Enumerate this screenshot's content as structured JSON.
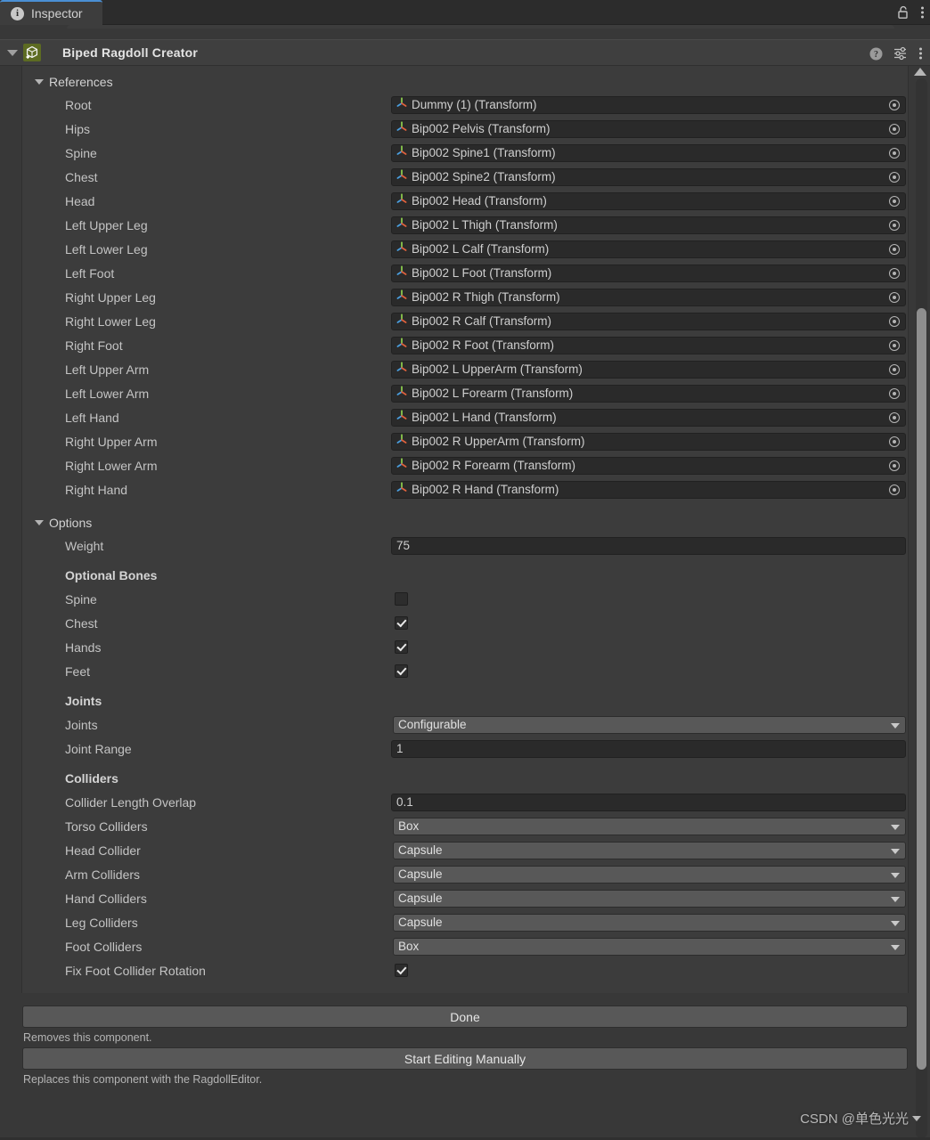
{
  "window": {
    "tab": {
      "label": "Inspector",
      "icon": "info-icon"
    },
    "tab_controls": [
      {
        "name": "lock-icon",
        "label": "Lock"
      },
      {
        "name": "more-menu-icon",
        "label": "More"
      }
    ]
  },
  "component": {
    "title": "Biped Ragdoll Creator",
    "icon": "script-cube-icon",
    "header_controls": [
      {
        "name": "help-icon",
        "label": "Help"
      },
      {
        "name": "preset-icon",
        "label": "Preset"
      },
      {
        "name": "component-menu-icon",
        "label": "Menu"
      }
    ]
  },
  "references": {
    "section_label": "References",
    "rows": [
      {
        "label": "Root",
        "value": "Dummy (1) (Transform)"
      },
      {
        "label": "Hips",
        "value": "Bip002 Pelvis (Transform)"
      },
      {
        "label": "Spine",
        "value": "Bip002 Spine1 (Transform)"
      },
      {
        "label": "Chest",
        "value": "Bip002 Spine2 (Transform)"
      },
      {
        "label": "Head",
        "value": "Bip002 Head (Transform)"
      },
      {
        "label": "Left Upper Leg",
        "value": "Bip002 L Thigh (Transform)"
      },
      {
        "label": "Left Lower Leg",
        "value": "Bip002 L Calf (Transform)"
      },
      {
        "label": "Left Foot",
        "value": "Bip002 L Foot (Transform)"
      },
      {
        "label": "Right Upper Leg",
        "value": "Bip002 R Thigh (Transform)"
      },
      {
        "label": "Right Lower Leg",
        "value": "Bip002 R Calf (Transform)"
      },
      {
        "label": "Right Foot",
        "value": "Bip002 R Foot (Transform)"
      },
      {
        "label": "Left Upper Arm",
        "value": "Bip002 L UpperArm (Transform)"
      },
      {
        "label": "Left Lower Arm",
        "value": "Bip002 L Forearm (Transform)"
      },
      {
        "label": "Left Hand",
        "value": "Bip002 L Hand (Transform)"
      },
      {
        "label": "Right Upper Arm",
        "value": "Bip002 R UpperArm (Transform)"
      },
      {
        "label": "Right Lower Arm",
        "value": "Bip002 R Forearm (Transform)"
      },
      {
        "label": "Right Hand",
        "value": "Bip002 R Hand (Transform)"
      }
    ]
  },
  "options": {
    "section_label": "Options",
    "weight": {
      "label": "Weight",
      "value": "75"
    },
    "optional_bones": {
      "header": "Optional Bones",
      "items": [
        {
          "label": "Spine",
          "checked": false
        },
        {
          "label": "Chest",
          "checked": true
        },
        {
          "label": "Hands",
          "checked": true
        },
        {
          "label": "Feet",
          "checked": true
        }
      ]
    },
    "joints": {
      "header": "Joints",
      "joints_type": {
        "label": "Joints",
        "value": "Configurable"
      },
      "joint_range": {
        "label": "Joint Range",
        "value": "1"
      }
    },
    "colliders": {
      "header": "Colliders",
      "length_overlap": {
        "label": "Collider Length Overlap",
        "value": "0.1"
      },
      "dropdowns": [
        {
          "label": "Torso Colliders",
          "value": "Box"
        },
        {
          "label": "Head Collider",
          "value": "Capsule"
        },
        {
          "label": "Arm Colliders",
          "value": "Capsule"
        },
        {
          "label": "Hand Colliders",
          "value": "Capsule"
        },
        {
          "label": "Leg Colliders",
          "value": "Capsule"
        },
        {
          "label": "Foot Colliders",
          "value": "Box"
        }
      ],
      "fix_rotation": {
        "label": "Fix Foot Collider Rotation",
        "checked": true
      }
    }
  },
  "footer": {
    "done_button": "Done",
    "done_help": "Removes this component.",
    "manual_button": "Start Editing Manually",
    "manual_help": "Replaces this component with the RagdollEditor."
  },
  "watermark": {
    "text": "CSDN @单色光光"
  },
  "colors": {
    "accent_tab": "#4a8fd4",
    "panel_bg": "#3c3c3c",
    "window_bg": "#383838",
    "field_bg": "#2a2a2a",
    "dropdown_bg": "#585858",
    "component_icon_bg": "#5d6b22",
    "scrollbar_thumb": "#8e8e8e"
  }
}
